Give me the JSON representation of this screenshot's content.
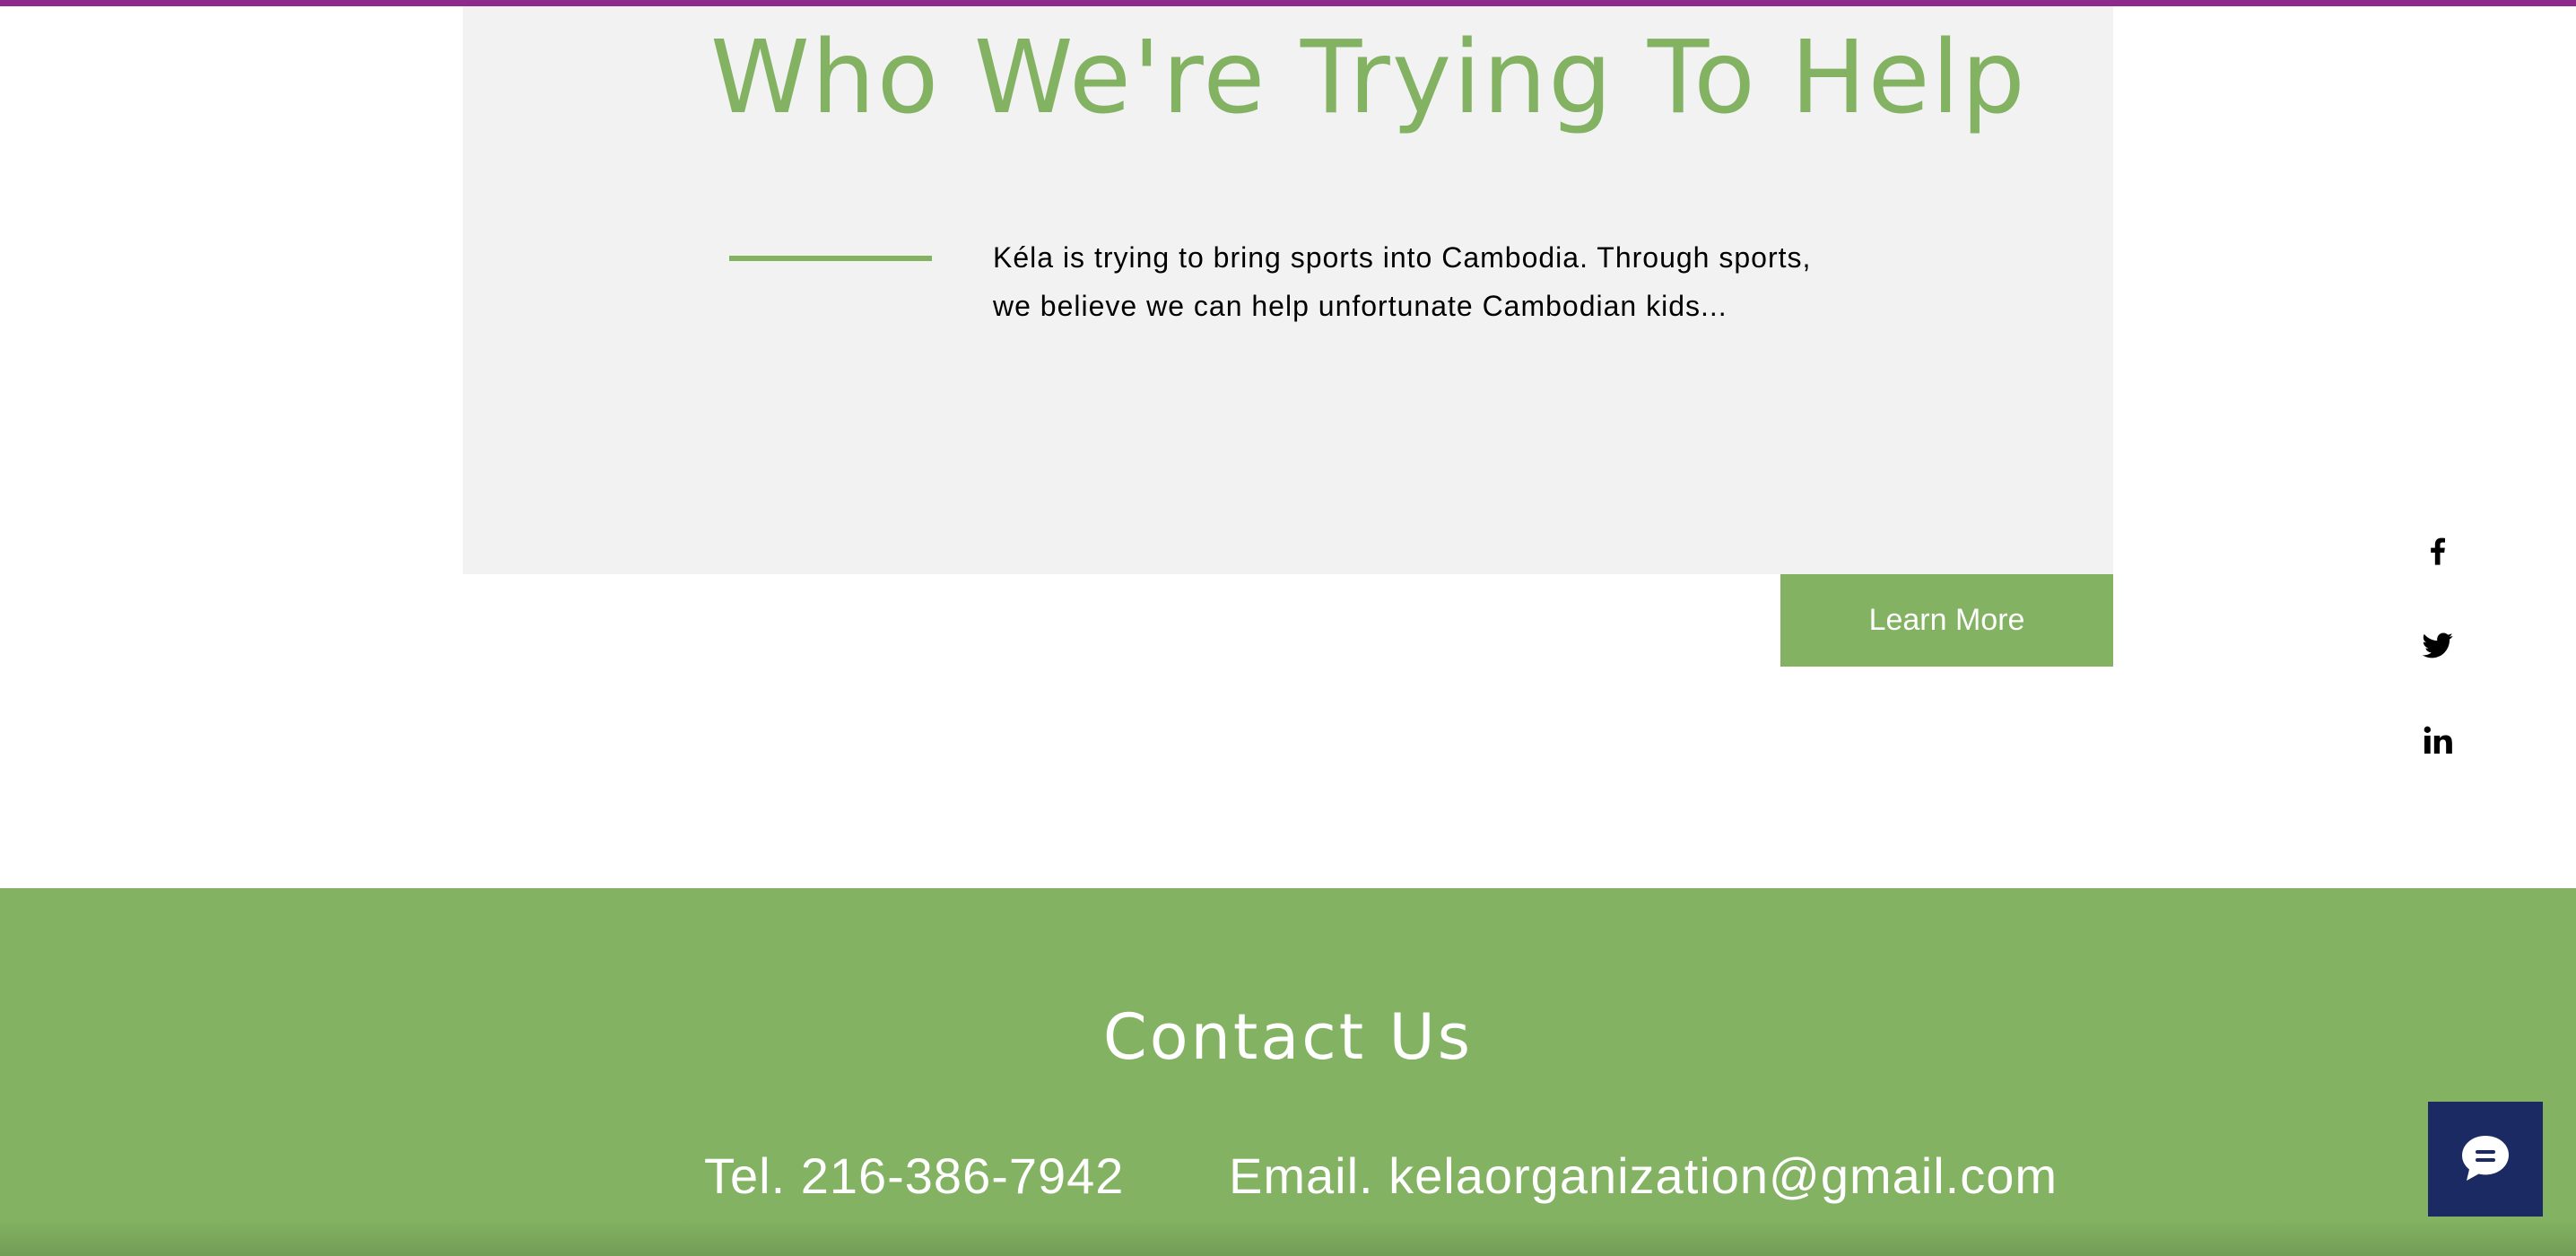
{
  "colors": {
    "accent_green": "#82b262",
    "panel_gray": "#f2f2f2",
    "top_strip": "#8e2a8e",
    "chat_navy": "#1c2a64"
  },
  "section": {
    "title": "Who We're Trying To Help",
    "body": "Kéla is trying to bring sports into Cambodia. Through sports,\nwe believe we can help unfortunate Cambodian kids...",
    "cta_label": "Learn More"
  },
  "social": {
    "items": [
      {
        "icon": "facebook-icon"
      },
      {
        "icon": "twitter-icon"
      },
      {
        "icon": "linkedin-icon"
      }
    ]
  },
  "footer": {
    "title": "Contact Us",
    "tel": "Tel. 216-386-7942",
    "email": "Email. kelaorganization@gmail.com"
  },
  "chat": {
    "icon": "chat-icon"
  }
}
